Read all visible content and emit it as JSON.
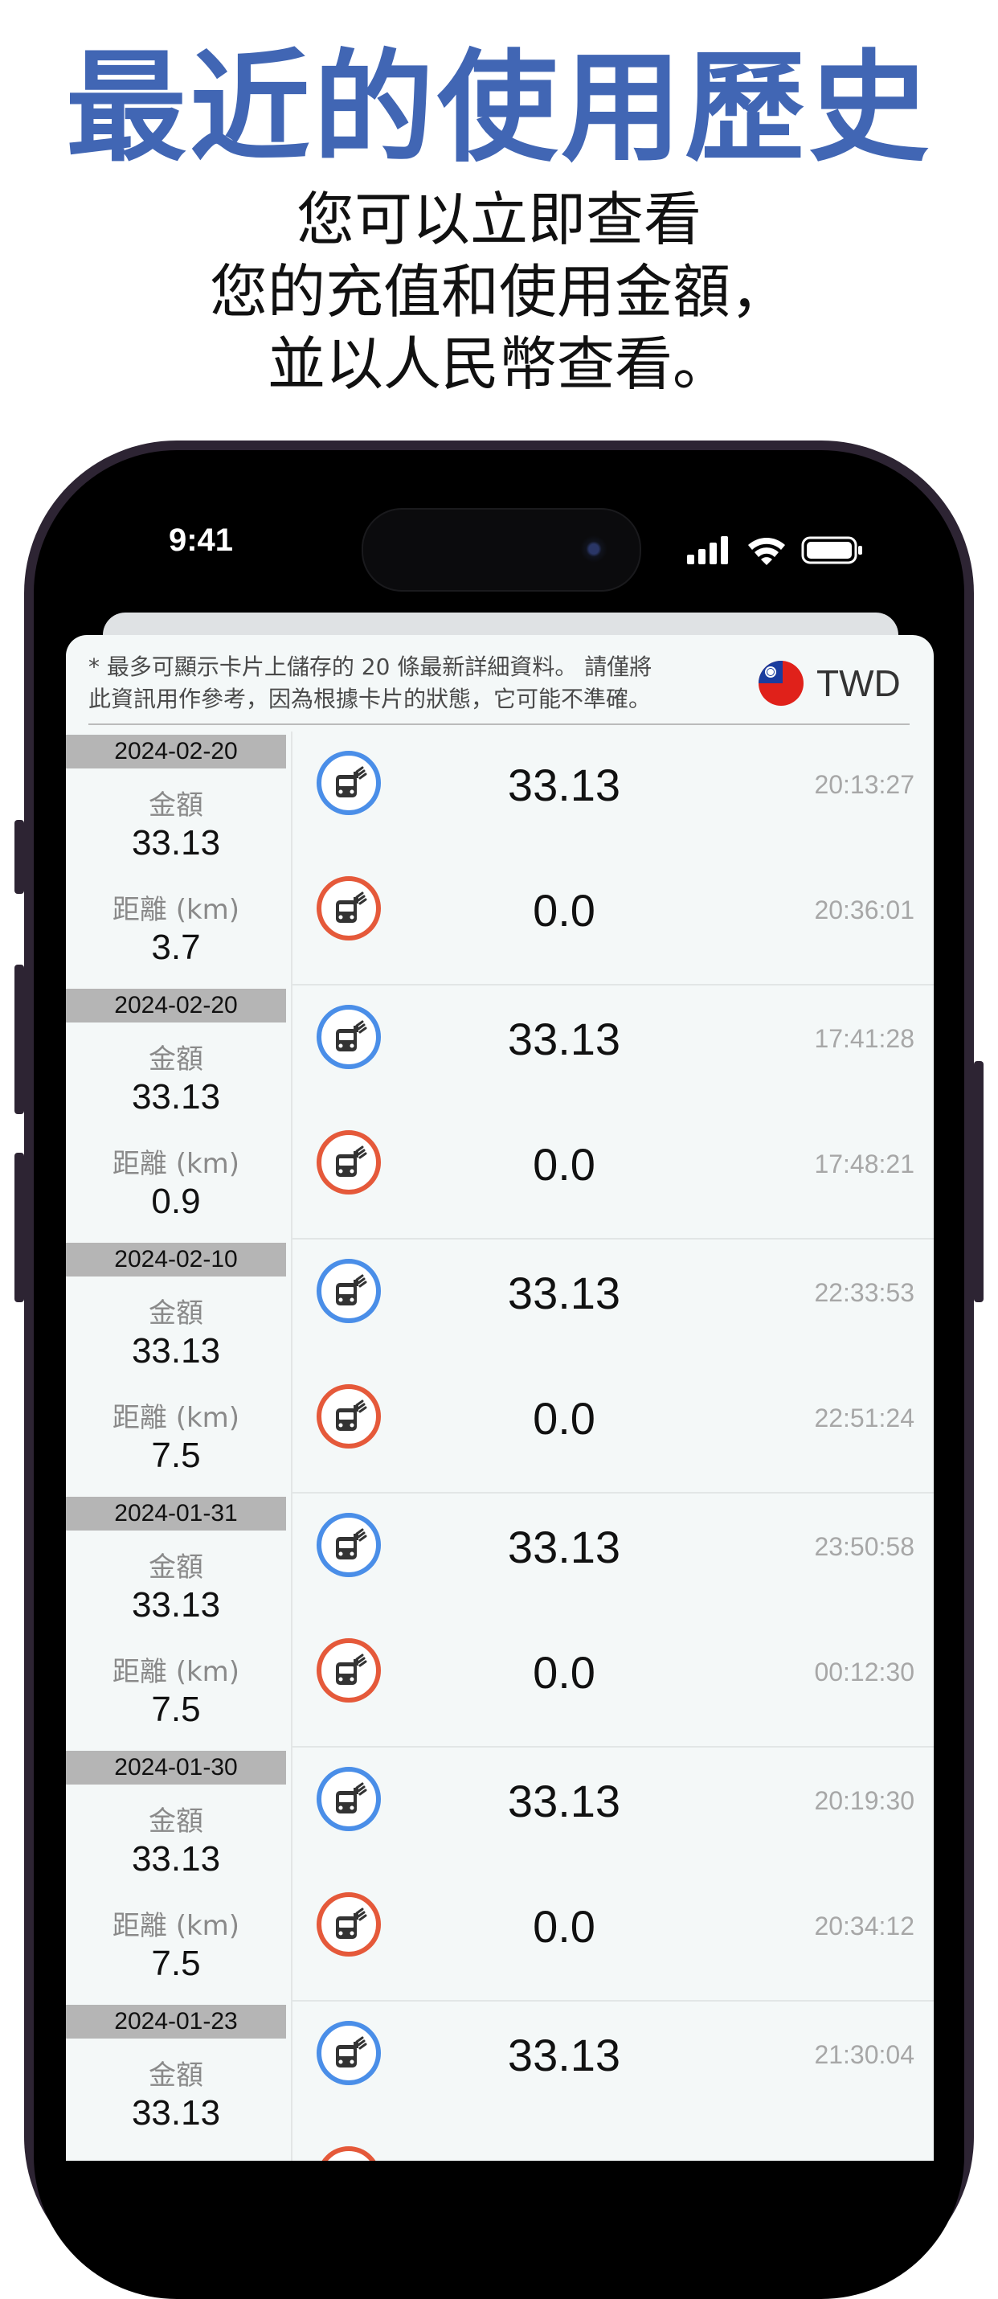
{
  "promo": {
    "title": "最近的使用歷史",
    "lines": [
      "您可以立即查看",
      "您的充值和使用金額，",
      "並以人民幣查看。"
    ]
  },
  "status_bar": {
    "time": "9:41",
    "icons": [
      "signal-icon",
      "wifi-icon",
      "battery-icon"
    ]
  },
  "header": {
    "notice_line1": "* 最多可顯示卡片上儲存的 20 條最新詳細資料。 請僅將",
    "notice_line2": "此資訊用作參考，因為根據卡片的狀態，它可能不準確。",
    "currency": "TWD",
    "flag_icon": "taiwan-flag-icon"
  },
  "labels": {
    "amount": "金額",
    "distance": "距離 (km)"
  },
  "colors": {
    "title": "#4166b4",
    "entry": "#4a8ee8",
    "exit": "#e5593a",
    "date_bar": "#b5b5b5"
  },
  "trips": [
    {
      "date": "2024-02-20",
      "amount": "33.13",
      "distance": "3.7",
      "entry": {
        "amount": "33.13",
        "time": "20:13:27"
      },
      "exit": {
        "amount": "0.0",
        "time": "20:36:01"
      }
    },
    {
      "date": "2024-02-20",
      "amount": "33.13",
      "distance": "0.9",
      "entry": {
        "amount": "33.13",
        "time": "17:41:28"
      },
      "exit": {
        "amount": "0.0",
        "time": "17:48:21"
      }
    },
    {
      "date": "2024-02-10",
      "amount": "33.13",
      "distance": "7.5",
      "entry": {
        "amount": "33.13",
        "time": "22:33:53"
      },
      "exit": {
        "amount": "0.0",
        "time": "22:51:24"
      }
    },
    {
      "date": "2024-01-31",
      "amount": "33.13",
      "distance": "7.5",
      "entry": {
        "amount": "33.13",
        "time": "23:50:58"
      },
      "exit": {
        "amount": "0.0",
        "time": "00:12:30"
      }
    },
    {
      "date": "2024-01-30",
      "amount": "33.13",
      "distance": "7.5",
      "entry": {
        "amount": "33.13",
        "time": "20:19:30"
      },
      "exit": {
        "amount": "0.0",
        "time": "20:34:12"
      }
    },
    {
      "date": "2024-01-23",
      "amount": "33.13",
      "distance": "",
      "entry": {
        "amount": "33.13",
        "time": "21:30:04"
      },
      "exit": {
        "amount": "",
        "time": ""
      }
    }
  ]
}
